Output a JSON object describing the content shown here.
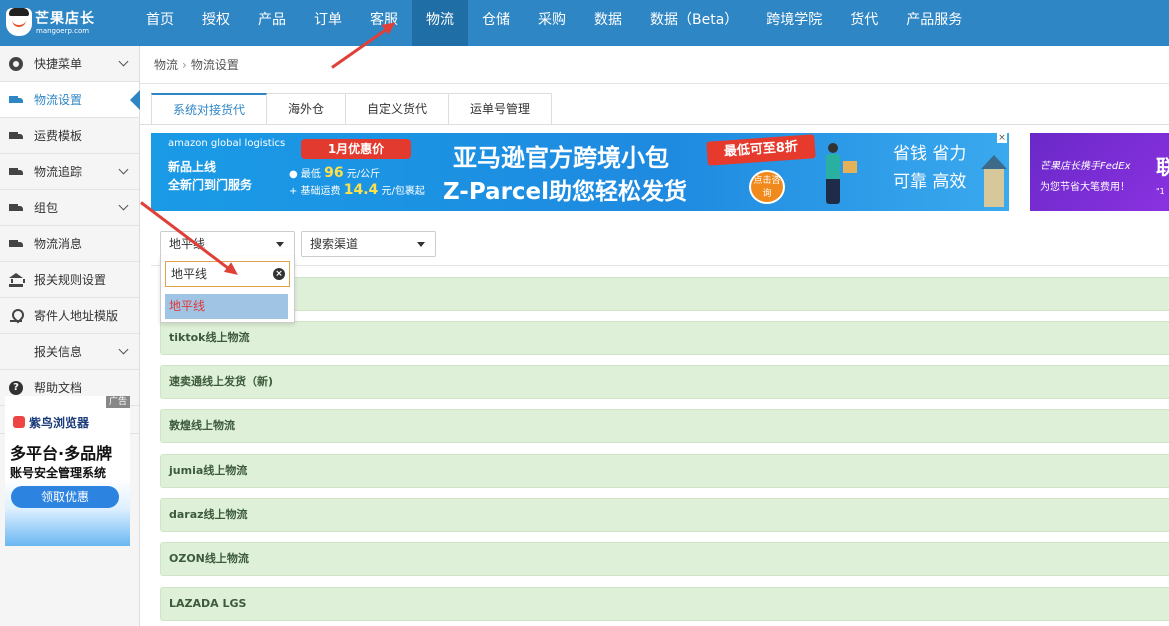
{
  "header": {
    "logo_name": "芒果店长",
    "logo_url": "mangoerp.com",
    "nav": [
      "首页",
      "授权",
      "产品",
      "订单",
      "客服",
      "物流",
      "仓储",
      "采购",
      "数据",
      "数据（Beta）",
      "跨境学院",
      "货代",
      "产品服务"
    ],
    "active_nav": "物流"
  },
  "sidebar": {
    "items": [
      {
        "label": "快捷菜单",
        "icon": "gear-icon",
        "has_chevron": true
      },
      {
        "label": "物流设置",
        "icon": "truck-icon",
        "has_chevron": false,
        "active": true
      },
      {
        "label": "运费模板",
        "icon": "truck-icon",
        "has_chevron": false
      },
      {
        "label": "物流追踪",
        "icon": "truck-icon",
        "has_chevron": true
      },
      {
        "label": "组包",
        "icon": "truck-icon",
        "has_chevron": true
      },
      {
        "label": "物流消息",
        "icon": "truck-icon",
        "has_chevron": false
      },
      {
        "label": "报关规则设置",
        "icon": "bank-icon",
        "has_chevron": false
      },
      {
        "label": "寄件人地址模版",
        "icon": "map-pin-icon",
        "has_chevron": false
      },
      {
        "label": "报关信息",
        "icon": "",
        "has_chevron": true
      },
      {
        "label": "帮助文档",
        "icon": "help-icon",
        "has_chevron": false
      }
    ],
    "collapse_symbol": "«"
  },
  "side_ad": {
    "tag": "广告",
    "brand": "紫鸟浏览器",
    "line1": "多平台·多品牌",
    "line2": "账号安全管理系统",
    "cta": "领取优惠"
  },
  "breadcrumb": {
    "root": "物流",
    "sep": "›",
    "current": "物流设置"
  },
  "tabs": [
    "系统对接货代",
    "海外仓",
    "自定义货代",
    "运单号管理"
  ],
  "banner": {
    "amazon": "amazon global logistics",
    "new_line1": "新品上线",
    "new_line2": "全新门到门服务",
    "promo": "1月优惠价",
    "price1_prefix": "● 最低 ",
    "price1_value": "96",
    "price1_unit": " 元/公斤",
    "price2_prefix": "+ 基础运费 ",
    "price2_value": "14.4",
    "price2_unit": " 元/包裹起",
    "headline1": "亚马逊官方跨境小包",
    "headline2": "Z-Parcel助您轻松发货",
    "discount": "最低可至8折",
    "consult": "点击咨询",
    "slogan1": "省钱 省力",
    "slogan2": "可靠 高效",
    "close": "×"
  },
  "banner2": {
    "line1": "芒果店长携手FedEx",
    "line2": "为您节省大笔费用！",
    "big": "联",
    "small": "\"1"
  },
  "filters": {
    "carrier_select": "地平线",
    "channel_select": "搜索渠道"
  },
  "dropdown": {
    "search_value": "地平线",
    "option": "地平线"
  },
  "list": [
    "tiktok线上物流",
    "速卖通线上发货（新)",
    "敦煌线上物流",
    "jumia线上物流",
    "daraz线上物流",
    "OZON线上物流",
    "LAZADA LGS"
  ],
  "colors": {
    "nav_bg": "#2f86c4",
    "accent": "#2f86c4",
    "list_bg": "#dff0d8",
    "arrow": "#e0403a"
  }
}
